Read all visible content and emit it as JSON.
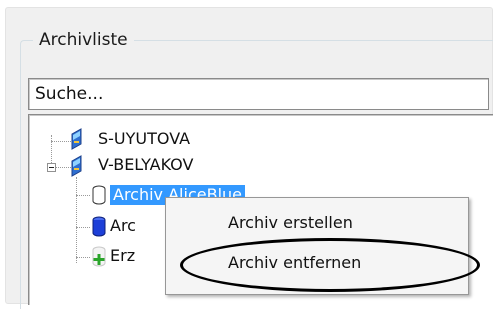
{
  "groupbox": {
    "title": "Archivliste"
  },
  "search": {
    "value": "Suche..."
  },
  "tree": {
    "items": [
      {
        "label": "S-UYUTOVA"
      },
      {
        "label": "V-BELYAKOV"
      },
      {
        "label": "Archiv AliceBlue"
      },
      {
        "label": "Arc"
      },
      {
        "label": "Erz"
      }
    ]
  },
  "context_menu": {
    "items": [
      {
        "label": "Archiv erstellen"
      },
      {
        "label": "Archiv entfernen"
      }
    ]
  },
  "colors": {
    "selection": "#3399ff",
    "archive_blue": "#1d3fd8",
    "add_green": "#2aa52a",
    "annotation": "#000000"
  }
}
